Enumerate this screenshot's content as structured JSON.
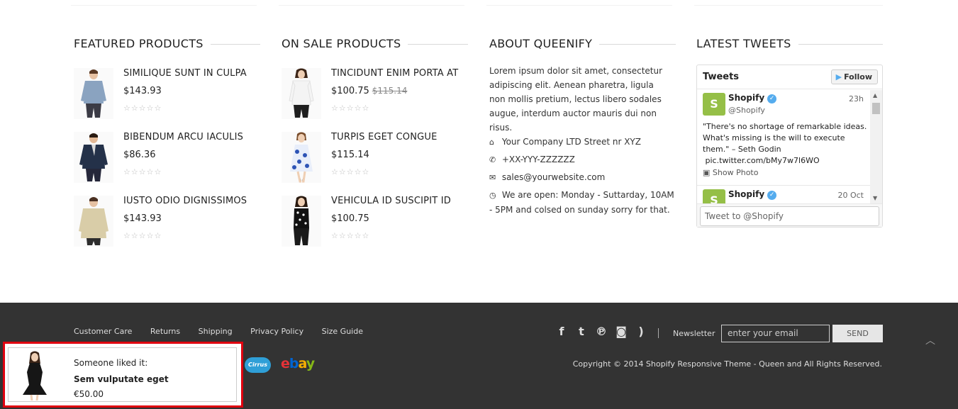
{
  "featured": {
    "title": "FEATURED PRODUCTS",
    "products": [
      {
        "name": "SIMILIQUE SUNT IN CULPA",
        "price": "$143.93",
        "rating": "☆☆☆☆☆"
      },
      {
        "name": "BIBENDUM ARCU IACULIS",
        "price": "$86.36",
        "rating": "☆☆☆☆☆"
      },
      {
        "name": "IUSTO ODIO DIGNISSIMOS",
        "price": "$143.93",
        "rating": "☆☆☆☆☆"
      }
    ]
  },
  "on_sale": {
    "title": "ON SALE PRODUCTS",
    "products": [
      {
        "name": "TINCIDUNT ENIM PORTA AT",
        "price": "$100.75",
        "old_price": "$115.14",
        "rating": "☆☆☆☆☆"
      },
      {
        "name": "TURPIS EGET CONGUE",
        "price": "$115.14",
        "rating": "☆☆☆☆☆"
      },
      {
        "name": "VEHICULA ID SUSCIPIT ID",
        "price": "$100.75",
        "rating": "☆☆☆☆☆"
      }
    ]
  },
  "about": {
    "title": "ABOUT QUEENIFY",
    "text": "Lorem ipsum dolor sit amet, consectetur adipiscing elit. Aenean pharetra, ligula non mollis pretium, lectus libero sodales augue, interdum auctor mauris dui non risus.",
    "address": "Your Company LTD Street nr XYZ",
    "phone": "+XX-YYY-ZZZZZZ",
    "email": "sales@yourwebsite.com",
    "hours": "We are open: Monday - Suttarday, 10AM - 5PM and colsed on sunday sorry for that."
  },
  "tweets": {
    "title": "LATEST TWEETS",
    "widget_title": "Tweets",
    "follow_label": "Follow",
    "items": [
      {
        "user": "Shopify",
        "handle": "@Shopify",
        "time": "23h",
        "text": "\"There's no shortage of remarkable ideas. What's missing is the will to execute them.\" – Seth Godin",
        "link": "pic.twitter.com/bMy7w7l6WO",
        "photo_label": "Show Photo"
      },
      {
        "user": "Shopify",
        "time": "20 Oct"
      }
    ],
    "input_placeholder": "Tweet to @Shopify"
  },
  "footer": {
    "links": [
      "Customer Care",
      "Returns",
      "Shipping",
      "Privacy Policy",
      "Size Guide"
    ],
    "social_icons": [
      "facebook-icon",
      "twitter-icon",
      "pinterest-icon",
      "instagram-icon",
      "rss-icon"
    ],
    "newsletter_label": "Newsletter",
    "newsletter_placeholder": "enter your email",
    "send_label": "SEND",
    "copyright": "Copyright © 2014 Shopify Responsive Theme - Queen and All Rights Reserved.",
    "payment_cirrus": "Cirrus",
    "payment_ebay": {
      "e": "e",
      "b": "b",
      "a": "a",
      "y": "y"
    }
  },
  "notification": {
    "line1": "Someone liked it:",
    "product": "Sem vulputate eget",
    "price": "€50.00"
  },
  "colors": {
    "footer_bg": "#333333",
    "notification_border": "#e0000f",
    "twitter_blue": "#55acee",
    "shopify_green": "#95bf47"
  }
}
